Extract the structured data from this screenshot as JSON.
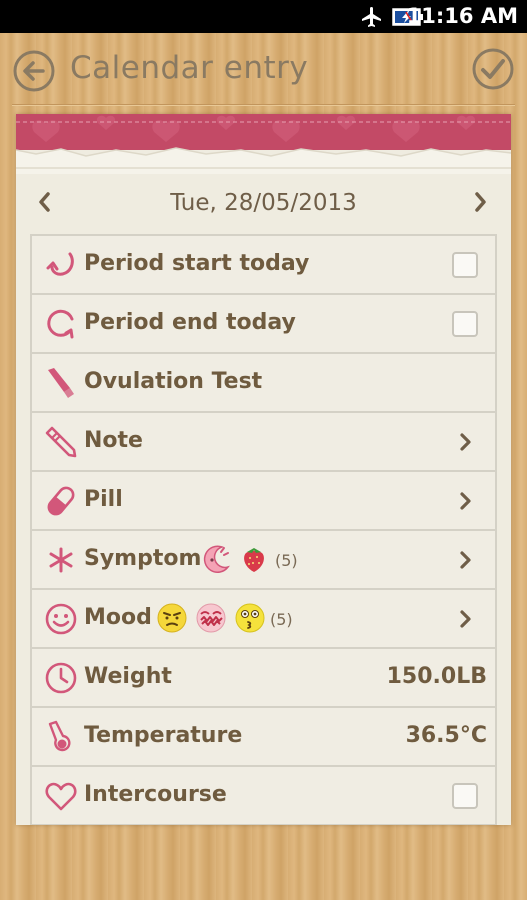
{
  "status_bar": {
    "time": "11:16 AM",
    "icons": [
      "airplane-icon",
      "battery-charging-icon"
    ]
  },
  "header": {
    "title": "Calendar entry",
    "back_icon": "back-arrow-icon",
    "done_icon": "checkmark-icon"
  },
  "date_nav": {
    "date": "Tue, 28/05/2013",
    "prev_icon": "chevron-left-icon",
    "next_icon": "chevron-right-icon"
  },
  "rows": [
    {
      "label": "Period start today",
      "icon": "period-start-icon",
      "control": "checkbox",
      "checked": false
    },
    {
      "label": "Period end today",
      "icon": "period-end-icon",
      "control": "checkbox",
      "checked": false
    },
    {
      "label": "Ovulation Test",
      "icon": "ovulation-test-icon",
      "control": "none"
    },
    {
      "label": "Note",
      "icon": "pencil-icon",
      "control": "chevron"
    },
    {
      "label": "Pill",
      "icon": "pill-icon",
      "control": "chevron"
    },
    {
      "label": "Symptom",
      "icon": "asterisk-icon",
      "control": "chevron",
      "badges": [
        "crescent-face-icon",
        "strawberry-icon"
      ],
      "count": "(5)"
    },
    {
      "label": "Mood",
      "icon": "smiley-icon",
      "control": "chevron",
      "badges": [
        "angry-face-icon",
        "scribble-mouth-face-icon",
        "kiss-face-icon"
      ],
      "count": "(5)"
    },
    {
      "label": "Weight",
      "icon": "clock-icon",
      "control": "value",
      "value": "150.0LB"
    },
    {
      "label": "Temperature",
      "icon": "thermometer-icon",
      "control": "value",
      "value": "36.5°C"
    },
    {
      "label": "Intercourse",
      "icon": "heart-icon",
      "control": "checkbox",
      "checked": false
    }
  ],
  "colors": {
    "accent": "#d2577a",
    "header_band": "#c34a66",
    "label_text": "#6f5b3f",
    "paper": "#efece0"
  }
}
